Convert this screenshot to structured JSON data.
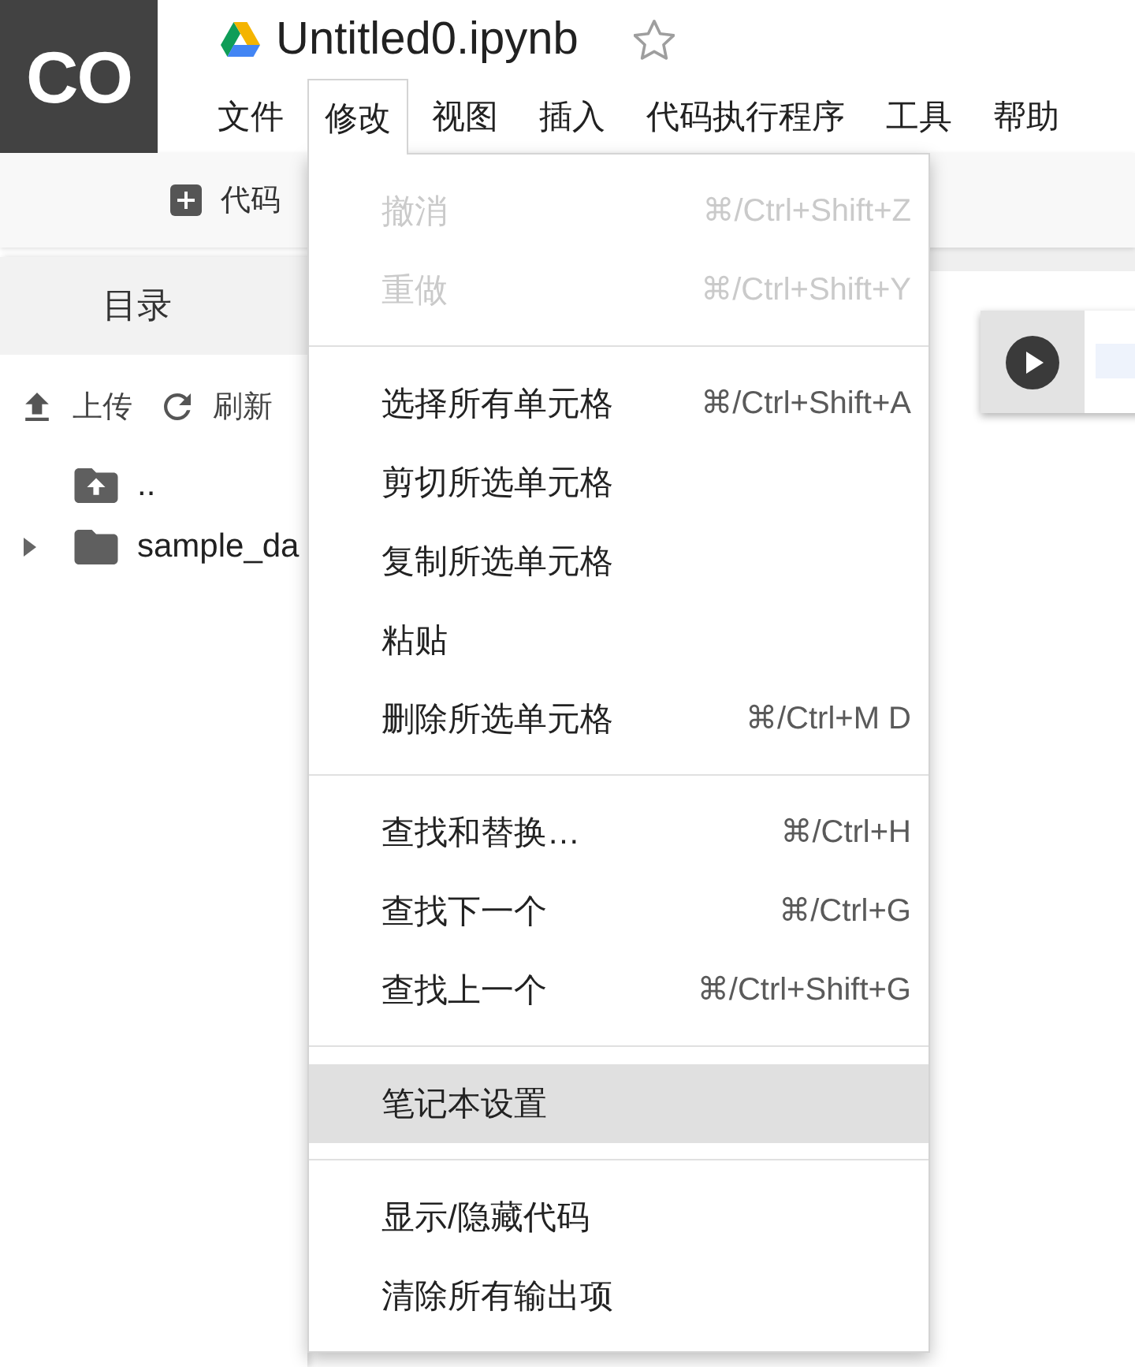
{
  "logo": {
    "text": "CO"
  },
  "notebook": {
    "title": "Untitled0.ipynb",
    "starred": false
  },
  "menubar": [
    {
      "label": "文件",
      "selected": false
    },
    {
      "label": "修改",
      "selected": true
    },
    {
      "label": "视图",
      "selected": false
    },
    {
      "label": "插入",
      "selected": false
    },
    {
      "label": "代码执行程序",
      "selected": false
    },
    {
      "label": "工具",
      "selected": false
    },
    {
      "label": "帮助",
      "selected": false
    }
  ],
  "toolbar": {
    "buttons": [
      {
        "kind": "add",
        "label": "代码"
      }
    ]
  },
  "sidebar": {
    "title": "目录",
    "actions": [
      {
        "kind": "upload",
        "label": "上传"
      },
      {
        "kind": "refresh",
        "label": "刷新"
      }
    ],
    "files": [
      {
        "kind": "parent",
        "name": ".."
      },
      {
        "kind": "folder",
        "name": "sample_da",
        "expanded": false
      }
    ]
  },
  "main": {
    "cells": [
      {
        "kind": "code"
      }
    ]
  },
  "menu": {
    "groups": [
      {
        "items": [
          {
            "label": "撤消",
            "shortcut": "⌘/Ctrl+Shift+Z",
            "disabled": true,
            "selected": false
          },
          {
            "label": "重做",
            "shortcut": "⌘/Ctrl+Shift+Y",
            "disabled": true,
            "selected": false
          }
        ]
      },
      {
        "items": [
          {
            "label": "选择所有单元格",
            "shortcut": "⌘/Ctrl+Shift+A",
            "disabled": false,
            "selected": false
          },
          {
            "label": "剪切所选单元格",
            "disabled": false,
            "selected": false
          },
          {
            "label": "复制所选单元格",
            "disabled": false,
            "selected": false
          },
          {
            "label": "粘贴",
            "disabled": false,
            "selected": false
          },
          {
            "label": "删除所选单元格",
            "shortcut": "⌘/Ctrl+M D",
            "disabled": false,
            "selected": false
          }
        ]
      },
      {
        "items": [
          {
            "label": "查找和替换…",
            "shortcut": "⌘/Ctrl+H",
            "disabled": false,
            "selected": false
          },
          {
            "label": "查找下一个",
            "shortcut": "⌘/Ctrl+G",
            "disabled": false,
            "selected": false
          },
          {
            "label": "查找上一个",
            "shortcut": "⌘/Ctrl+Shift+G",
            "disabled": false,
            "selected": false
          }
        ]
      },
      {
        "items": [
          {
            "label": "笔记本设置",
            "disabled": false,
            "selected": true
          }
        ]
      },
      {
        "items": [
          {
            "label": "显示/隐藏代码",
            "disabled": false,
            "selected": false
          },
          {
            "label": "清除所有输出项",
            "disabled": false,
            "selected": false
          }
        ]
      }
    ]
  }
}
